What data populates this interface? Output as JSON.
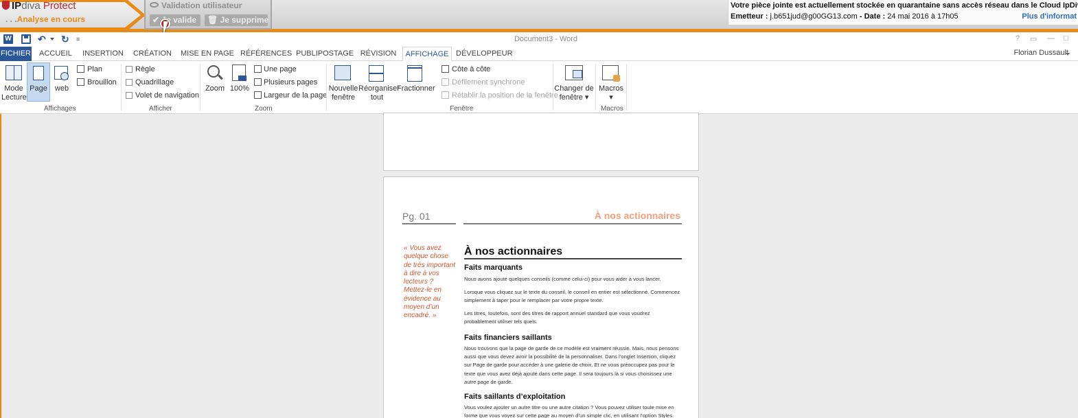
{
  "ipdiva": {
    "brand_word1": "IP",
    "brand_word2": "diva",
    "brand_word3": "Protect",
    "status": "Analyse en cours",
    "validation_title": "Validation utilisateur",
    "valid_button": "Je valide",
    "delete_button": "Je supprime",
    "notice_main": "Votre pièce jointe est actuellement stockée en quarantaine sans accès réseau dans le Cloud IpDiva Pro",
    "notice_sender_label": "Emetteur :",
    "notice_sender": "j.b651jud@g00GG13.com",
    "notice_date_label": "- Date :",
    "notice_date": "24 mai 2016 à 17h05",
    "notice_link": "Plus d'informat",
    "colors": {
      "accent": "#e88a17",
      "brand_red": "#c0272d"
    }
  },
  "word": {
    "document_title": "Document3 - Word",
    "window_controls": {
      "help": "?",
      "restore": "▭",
      "minimize": "—",
      "maximize": "□"
    },
    "qat": {
      "word_icon": "W",
      "undo": "↶",
      "redo": "↻",
      "customize": "≡"
    },
    "user_name": "Florian Dussault",
    "tabs": [
      "FICHIER",
      "ACCUEIL",
      "INSERTION",
      "CRÉATION",
      "MISE EN PAGE",
      "RÉFÉRENCES",
      "PUBLIPOSTAGE",
      "RÉVISION",
      "AFFICHAGE",
      "DÉVELOPPEUR"
    ],
    "active_tab": "AFFICHAGE",
    "ribbon": {
      "affichages": {
        "label": "Affichages",
        "mode_lecture_1": "Mode",
        "mode_lecture_2": "Lecture",
        "page": "Page",
        "web": "web",
        "plan": "Plan",
        "brouillon": "Brouillon"
      },
      "afficher": {
        "label": "Afficher",
        "regle": "Règle",
        "quadrillage": "Quadrillage",
        "volet": "Volet de navigation"
      },
      "zoom": {
        "label": "Zoom",
        "zoom": "Zoom",
        "cent": "100%",
        "une_page": "Une page",
        "plusieurs_pages": "Plusieurs pages",
        "largeur": "Largeur de la page"
      },
      "fenetre": {
        "label": "Fenêtre",
        "nouvelle_1": "Nouvelle",
        "nouvelle_2": "fenêtre",
        "reorganiser_1": "Réorganiser",
        "reorganiser_2": "tout",
        "fractionner": "Fractionner",
        "cote_a_cote": "Côte à côte",
        "defilement": "Défilement synchrone",
        "retablir": "Rétablir la position de la fenêtre",
        "changer_1": "Changer de",
        "changer_2": "fenêtre"
      },
      "macros": {
        "label": "Macros",
        "macros": "Macros"
      }
    }
  },
  "document": {
    "page_number": "Pg. 01",
    "header_title": "À nos actionnaires",
    "pull_quote": "« Vous avez quelque chose de très important à dire à vos lecteurs ? Mettez-le en évidence au moyen d’un encadré. »",
    "heading": "À nos actionnaires",
    "sections": [
      {
        "title": "Faits marquants",
        "paragraphs": [
          "Nous avons ajouté quelques conseils (comme celui-ci) pour vous aider à vous lancer.",
          "Lorsque vous cliquez sur le texte du conseil, le conseil en entier est sélectionné. Commencez simplement à taper pour le remplacer par votre propre texte.",
          "Les titres, toutefois, sont des titres de rapport annuel standard que vous voudrez probablement utiliser tels quels."
        ]
      },
      {
        "title": "Faits financiers saillants",
        "paragraphs": [
          "Nous trouvons que la page de garde de ce modèle est vraiment réussie. Mais, nous pensons aussi que vous devez avoir la possibilité de la personnaliser. Dans l’onglet Insertion, cliquez sur Page de garde pour accéder à une galerie de choix. Et ne vous préoccupez pas pour le texte que vous avez déjà ajouté dans cette page. Il sera toujours là si vous choisissez une autre page de garde."
        ]
      },
      {
        "title": "Faits saillants d’exploitation",
        "paragraphs": [
          "Vous voulez ajouter un autre titre ou une autre citation ? Vous pouvez utiliser toute mise en forme que vous voyez sur cette page au moyen d’un simple clic, en utilisant l’option Styles."
        ]
      }
    ]
  }
}
